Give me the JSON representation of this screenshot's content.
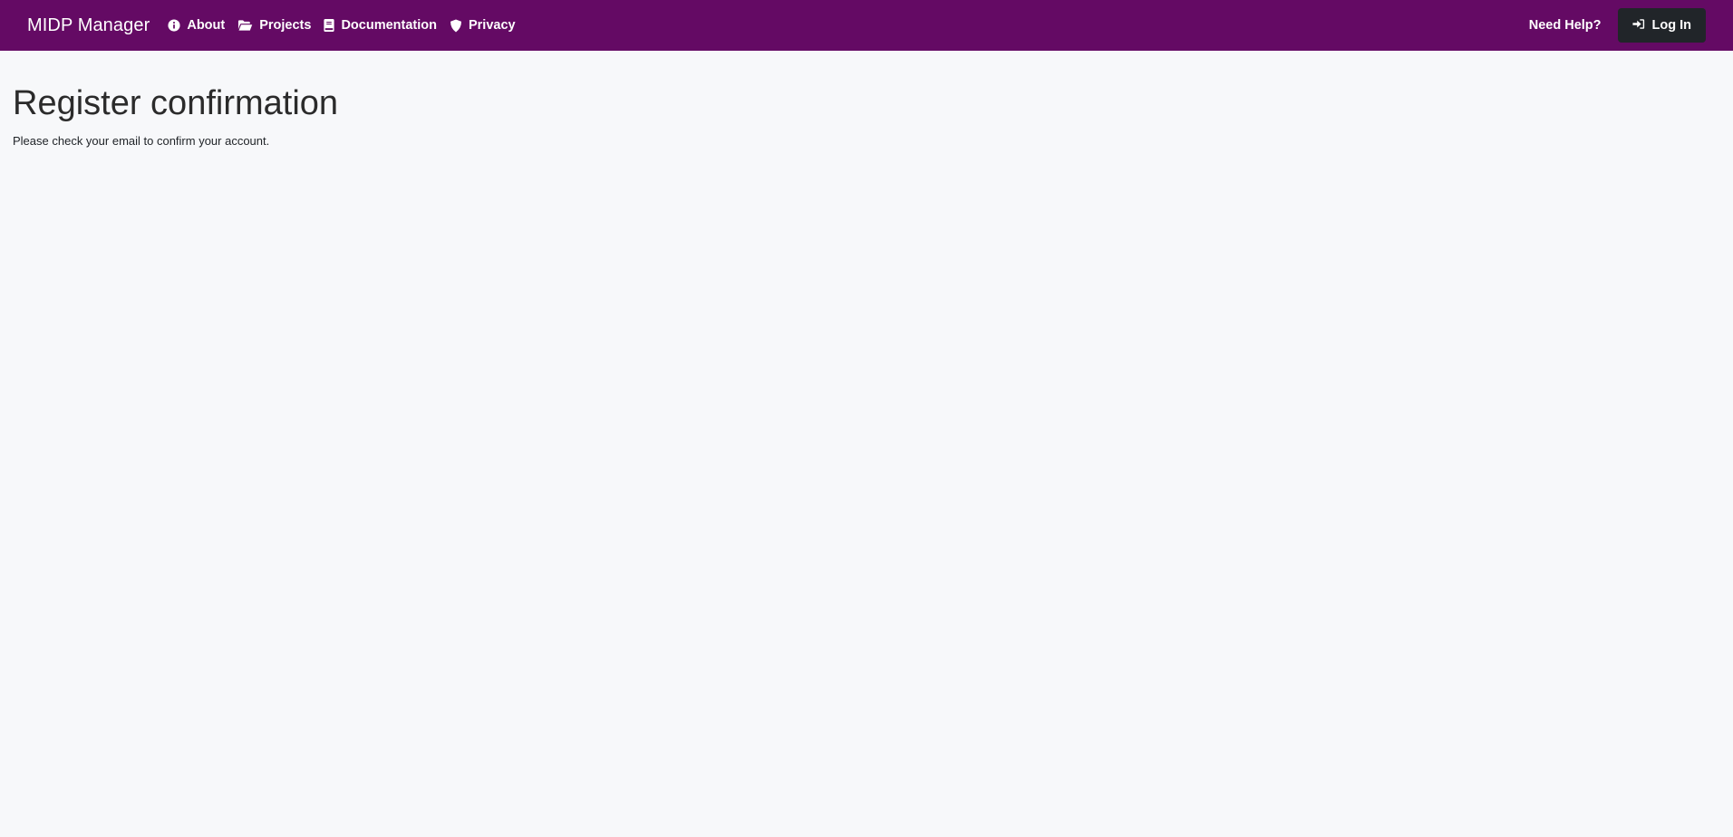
{
  "navbar": {
    "brand": "MIDP Manager",
    "links": [
      {
        "label": "About",
        "icon": "info-circle-icon"
      },
      {
        "label": "Projects",
        "icon": "folder-open-icon"
      },
      {
        "label": "Documentation",
        "icon": "book-icon"
      },
      {
        "label": "Privacy",
        "icon": "shield-icon"
      }
    ],
    "help_label": "Need Help?",
    "login_label": "Log In",
    "login_icon": "sign-in-icon",
    "background_color": "#640a64",
    "login_button_color": "#212529"
  },
  "main": {
    "title": "Register confirmation",
    "message": "Please check your email to confirm your account."
  }
}
